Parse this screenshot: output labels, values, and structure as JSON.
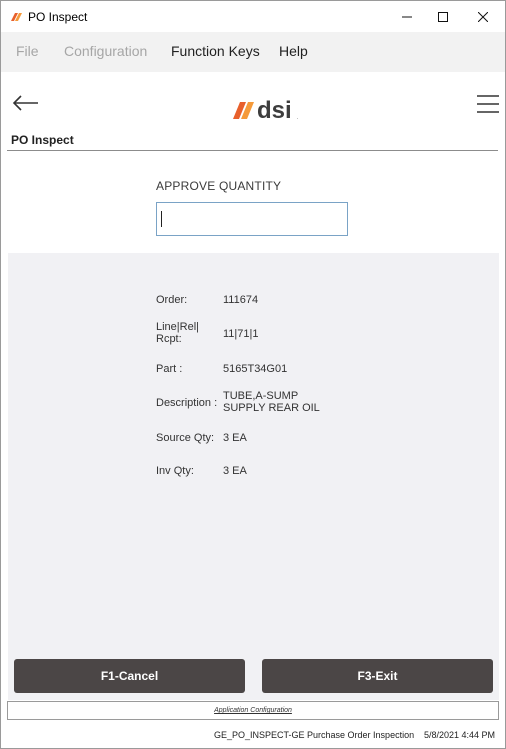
{
  "window": {
    "title": "PO Inspect",
    "controls": {
      "minimize": "–",
      "maximize": "☐",
      "close": "✕"
    }
  },
  "menu": {
    "items": [
      {
        "label": "File",
        "enabled": false
      },
      {
        "label": "Configuration",
        "enabled": false
      },
      {
        "label": "Function Keys",
        "enabled": true
      },
      {
        "label": "Help",
        "enabled": true
      }
    ]
  },
  "header": {
    "logo_text": "dsi",
    "logo_colors": {
      "accent": "#e8602c",
      "text": "#3d3d3d"
    },
    "page_title": "PO Inspect"
  },
  "approve": {
    "label": "APPROVE QUANTITY",
    "value": ""
  },
  "details": [
    {
      "label": "Order:",
      "value": "111674"
    },
    {
      "label": "Line|Rel|\nRcpt:",
      "value": "11|71|1"
    },
    {
      "label": "Part :",
      "value": "5165T34G01"
    },
    {
      "label": "Description :",
      "value": "TUBE,A-SUMP\nSUPPLY REAR OIL"
    },
    {
      "label": "Source Qty:",
      "value": "3 EA"
    },
    {
      "label": "Inv Qty:",
      "value": "3 EA"
    }
  ],
  "buttons": {
    "cancel": "F1-Cancel",
    "exit": "F3-Exit"
  },
  "footer": {
    "app_config": "Application Configuration",
    "status": "GE_PO_INSPECT-GE Purchase Order Inspection",
    "datetime": "5/8/2021 4:44 PM"
  }
}
